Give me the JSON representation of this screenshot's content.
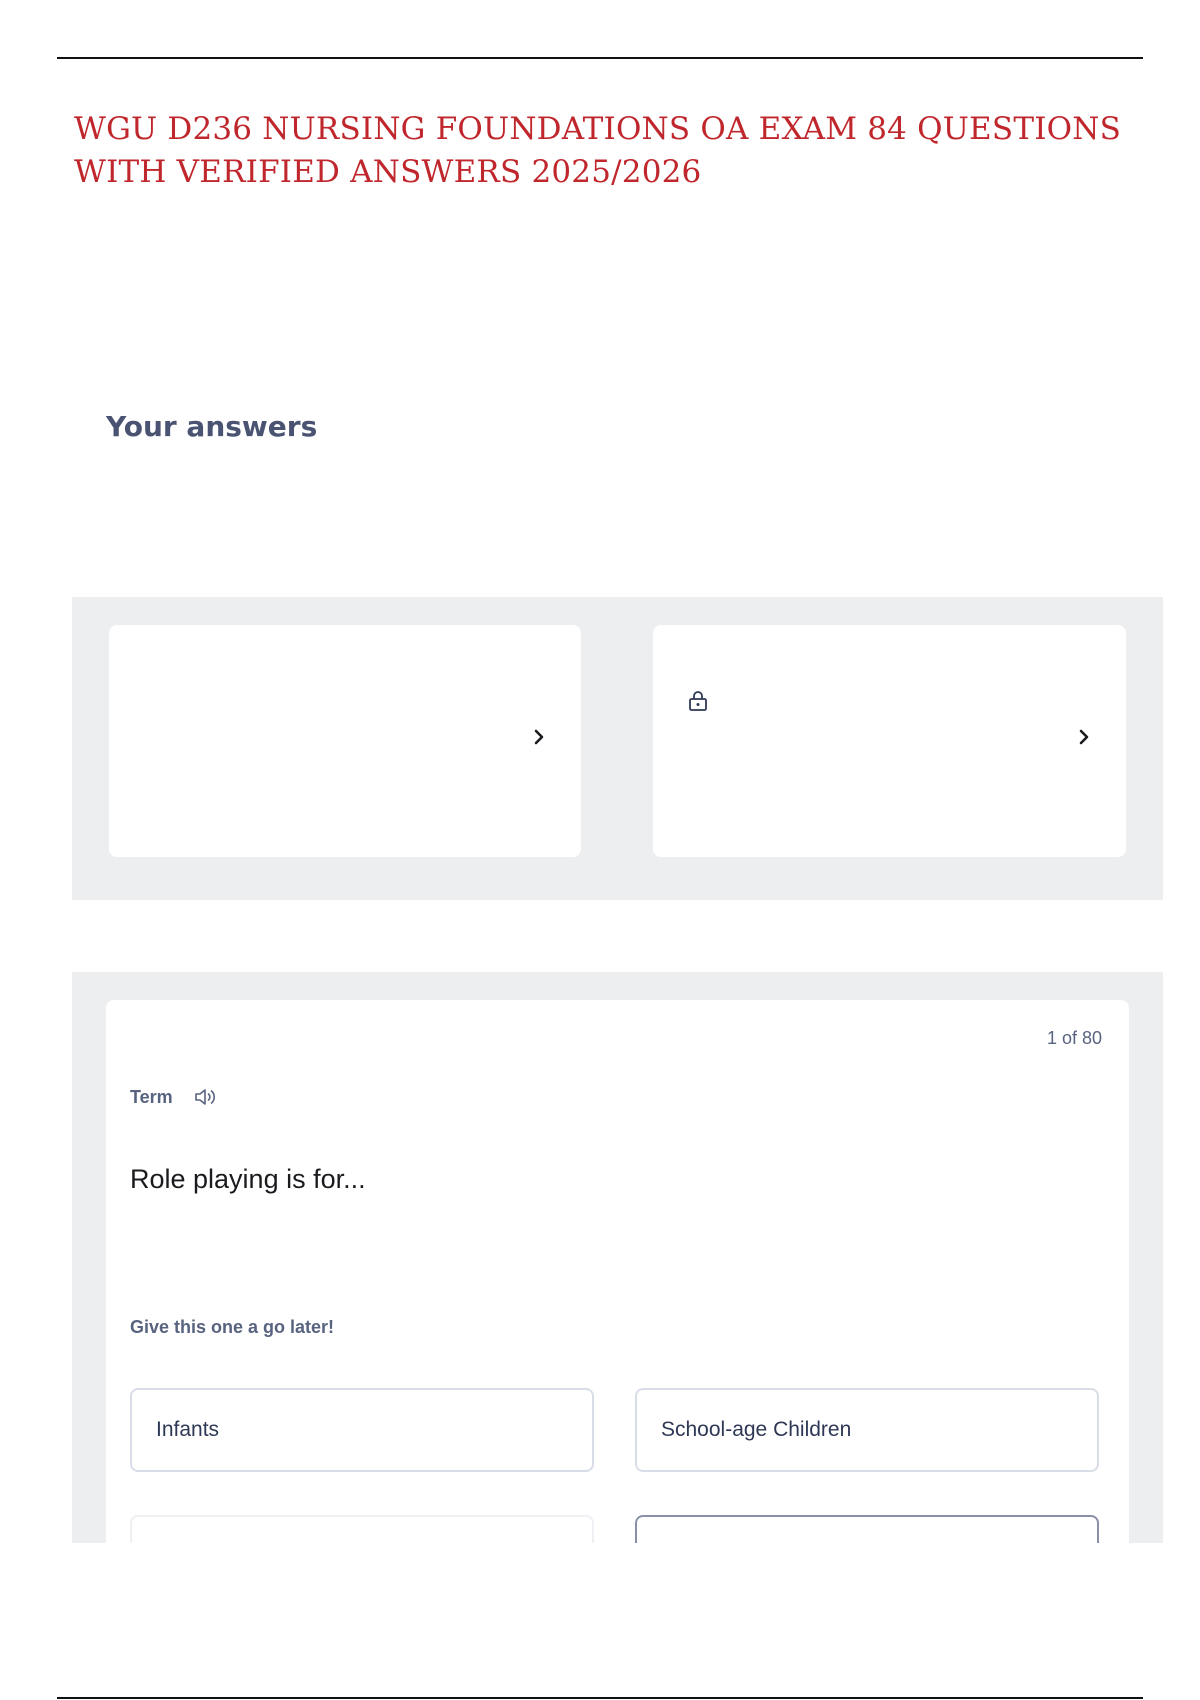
{
  "document": {
    "title_line1": "WGU D236 NURSING FOUNDATIONS OA EXAM 84 QUESTIONS",
    "title_line2": "WITH VERIFIED ANSWERS 2025/2026"
  },
  "answers_section": {
    "heading": "Your answers",
    "cards": [
      {
        "icon": "chevron-right-icon"
      },
      {
        "icon": "lock-icon",
        "nav_icon": "chevron-right-icon"
      }
    ]
  },
  "quiz": {
    "counter": "1 of 80",
    "term_label": "Term",
    "audio_icon": "speaker-icon",
    "question": "Role playing is for...",
    "hint": "Give this one a go later!",
    "options": [
      "Infants",
      "School-age Children",
      "",
      ""
    ]
  },
  "colors": {
    "title": "#c0272d",
    "heading": "#4a5472",
    "panel_bg": "#edeef0",
    "muted_text": "#586380",
    "option_border": "#d9dde8"
  }
}
